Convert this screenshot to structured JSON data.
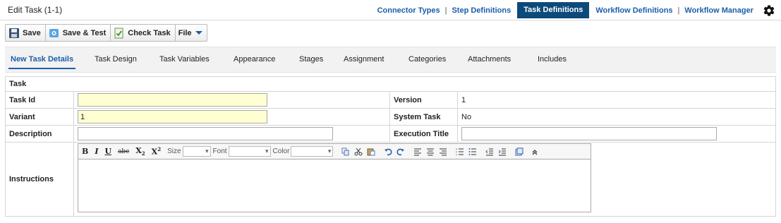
{
  "header": {
    "title": "Edit Task (1-1)",
    "nav": [
      {
        "label": "Connector Types"
      },
      {
        "label": "Step Definitions"
      },
      {
        "label": "Task Definitions",
        "active": true
      },
      {
        "label": "Workflow Definitions"
      },
      {
        "label": "Workflow Manager"
      }
    ],
    "separator": "|",
    "settings_icon": "gear-icon"
  },
  "toolbar": {
    "save_label": "Save",
    "save_test_label": "Save & Test",
    "check_task_label": "Check Task",
    "file_label": "File"
  },
  "tabs": [
    {
      "label": "New Task Details",
      "active": true
    },
    {
      "label": "Task Design"
    },
    {
      "label": "Task Variables"
    },
    {
      "label": "Appearance"
    },
    {
      "label": "Stages"
    },
    {
      "label": "Assignment"
    },
    {
      "label": "Categories"
    },
    {
      "label": "Attachments"
    },
    {
      "label": "Includes"
    }
  ],
  "form": {
    "section_label": "Task",
    "task_id": {
      "label": "Task Id",
      "value": ""
    },
    "variant": {
      "label": "Variant",
      "value": "1"
    },
    "description": {
      "label": "Description",
      "value": ""
    },
    "version": {
      "label": "Version",
      "value": "1"
    },
    "system_task": {
      "label": "System Task",
      "value": "No"
    },
    "execution_title": {
      "label": "Execution Title",
      "value": ""
    },
    "instructions": {
      "label": "Instructions",
      "value": ""
    }
  },
  "editor": {
    "bold": "B",
    "italic": "I",
    "underline": "U",
    "strike": "abc",
    "subscript": "X",
    "superscript": "X",
    "size_label": "Size",
    "font_label": "Font",
    "color_label": "Color"
  },
  "colors": {
    "accent": "#1a5fa8",
    "active_nav_bg": "#0c4a7a",
    "required_field_bg": "#ffffd2",
    "tab_bar_bg": "#f2f2f2"
  }
}
